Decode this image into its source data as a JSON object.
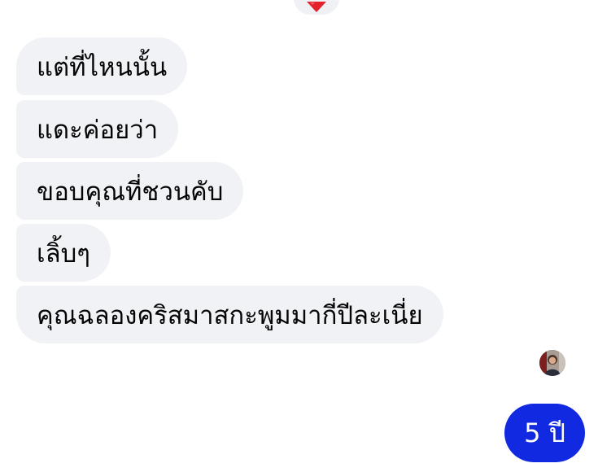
{
  "reaction": {
    "icon": "heart-icon",
    "color": "#e3222b"
  },
  "messages_received": [
    {
      "text": "แต่ที่ไหนนั้น"
    },
    {
      "text": "แดะค่อยว่า"
    },
    {
      "text": "ขอบคุณที่ชวนคับ"
    },
    {
      "text": "เลิ้บๆ"
    },
    {
      "text": "คุณฉลองคริสมาสกะพูมมากี่ปีละเนี่ย"
    }
  ],
  "sender_avatar": {
    "icon": "profile-photo"
  },
  "messages_sent": [
    {
      "text": "5 ปี"
    }
  ],
  "colors": {
    "received_bubble": "#f1f2f6",
    "sent_bubble": "#1129e0"
  }
}
